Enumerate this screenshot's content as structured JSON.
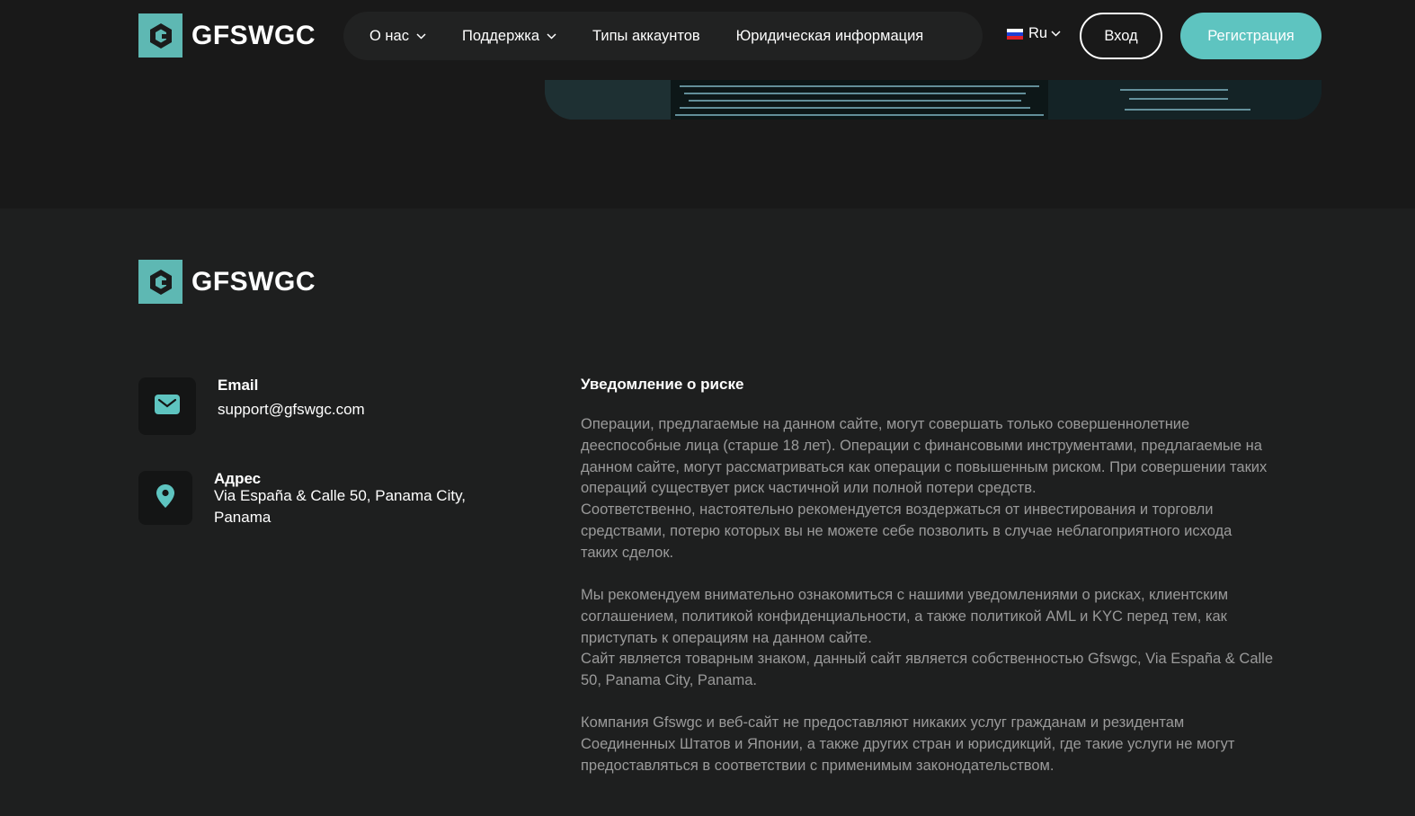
{
  "brand": {
    "name": "GFSWGC",
    "accent": "#5eb8b3"
  },
  "nav": {
    "items": [
      {
        "label": "О нас",
        "has_dropdown": true
      },
      {
        "label": "Поддержка",
        "has_dropdown": true
      },
      {
        "label": "Типы аккаунтов",
        "has_dropdown": false
      },
      {
        "label": "Юридическая информация",
        "has_dropdown": false
      }
    ],
    "language": "Ru",
    "login_label": "Вход",
    "register_label": "Регистрация"
  },
  "footer": {
    "email": {
      "title": "Email",
      "value": "support@gfswgc.com",
      "icon": "mail-icon"
    },
    "address": {
      "title": "Адрес",
      "line1": "Via España & Calle 50, Panama City,",
      "line2": "Panama",
      "icon": "location-pin-icon"
    },
    "risk": {
      "title": "Уведомление о риске",
      "p1": [
        "Операции, предлагаемые на данном сайте, могут совершать только совершеннолетние",
        "дееспособные лица (старше 18 лет). Операции с финансовыми инструментами, предлагаемые на",
        "данном сайте, могут рассматриваться как операции с повышенным риском. При совершении таких",
        "операций существует риск частичной или полной потери средств.",
        "Соответственно, настоятельно рекомендуется воздержаться от инвестирования и торговли",
        "средствами, потерю которых вы не можете себе позволить в случае неблагоприятного исхода",
        "таких сделок."
      ],
      "p2": [
        "Мы рекомендуем внимательно ознакомиться с нашими уведомлениями о рисках, клиентским",
        "соглашением, политикой конфиденциальности, а также политикой AML и KYC перед тем, как",
        "приступать к операциям на данном сайте.",
        "Сайт является товарным знаком, данный сайт является собственностью Gfswgc, Via España & Calle",
        "50, Panama City, Panama."
      ],
      "p3": [
        "Компания Gfswgc и веб-сайт не предоставляют никаких услуг гражданам и резидентам",
        "Соединенных Штатов и Японии, а также других стран и юрисдикций, где такие услуги не могут",
        "предоставляться в соответствии с применимым законодательством."
      ]
    }
  }
}
